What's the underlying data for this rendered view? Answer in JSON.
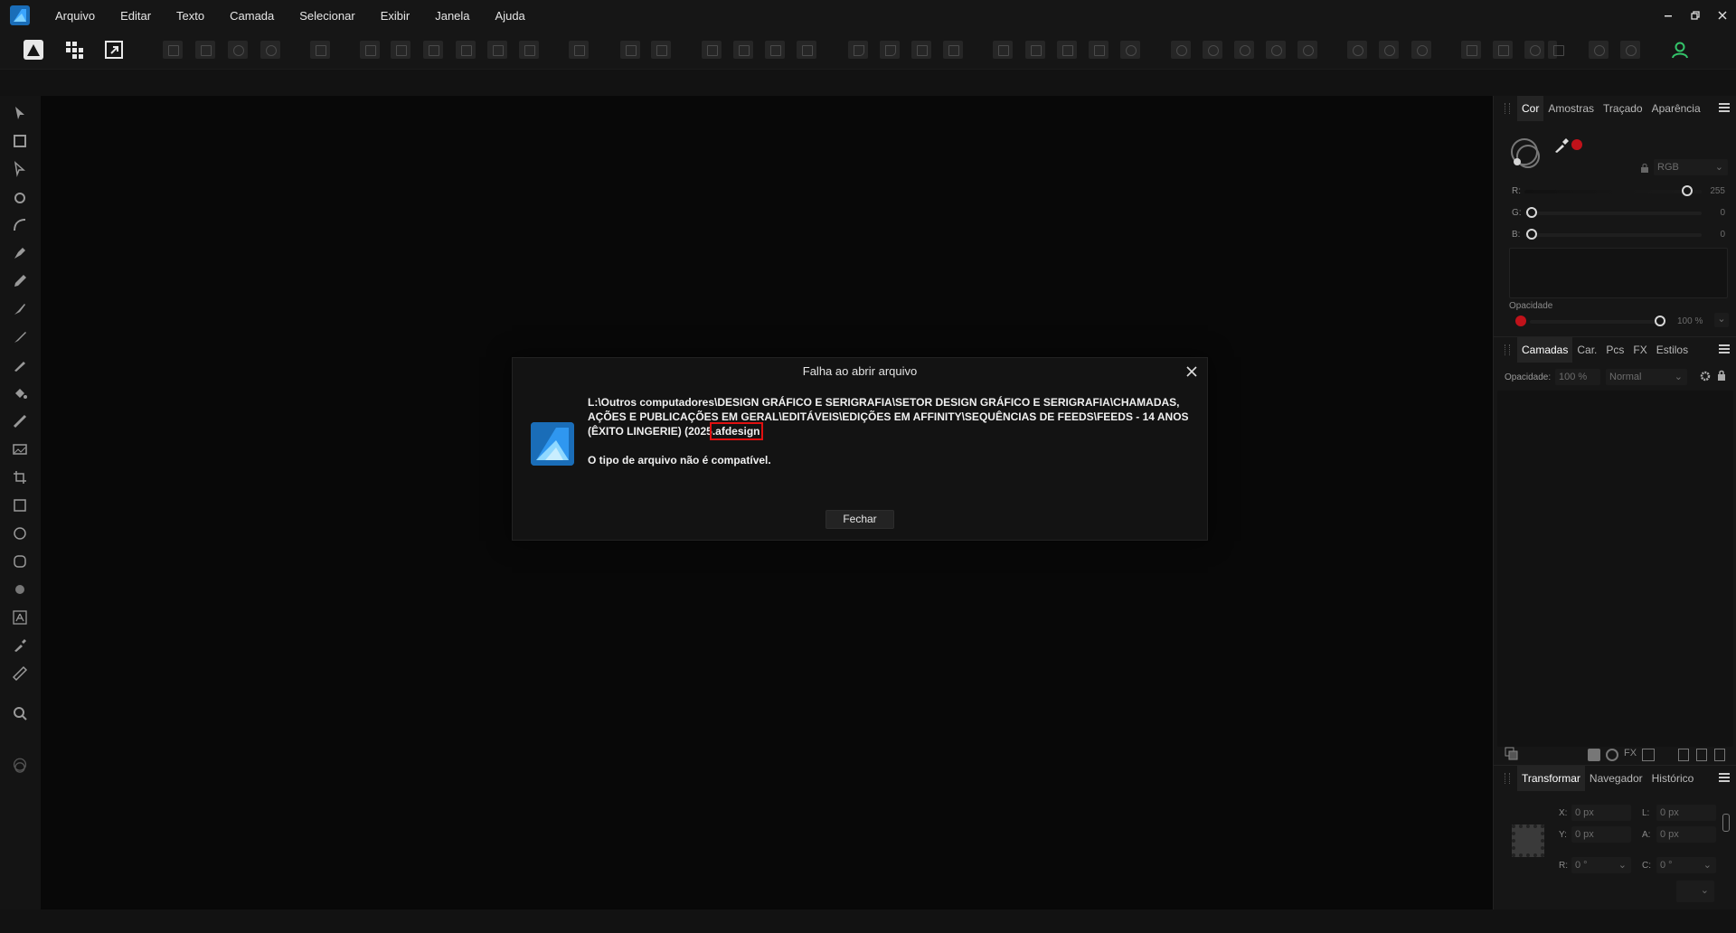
{
  "menubar": {
    "items": [
      "Arquivo",
      "Editar",
      "Texto",
      "Camada",
      "Selecionar",
      "Exibir",
      "Janela",
      "Ajuda"
    ]
  },
  "colors": {
    "accent": "#1a6db8",
    "highlight": "#e01010",
    "active_color": "#c0121a"
  },
  "color_panel": {
    "tabs": [
      "Cor",
      "Amostras",
      "Traçado",
      "Aparência"
    ],
    "mode": "RGB",
    "r_label": "R:",
    "r_value": "255",
    "g_label": "G:",
    "g_value": "0",
    "b_label": "B:",
    "b_value": "0",
    "opacity_label": "Opacidade",
    "opacity_value": "100 %",
    "icons": [
      "color-wheel-icon",
      "eyedropper-icon",
      "lock-icon"
    ]
  },
  "layers_panel": {
    "tabs": [
      "Camadas",
      "Car.",
      "Pcs",
      "FX",
      "Estilos"
    ],
    "opacity_label": "Opacidade:",
    "opacity_value": "100 %",
    "blend_mode": "Normal"
  },
  "transform_panel": {
    "tabs": [
      "Transformar",
      "Navegador",
      "Histórico"
    ],
    "x_label": "X:",
    "x_value": "0 px",
    "y_label": "Y:",
    "y_value": "0 px",
    "w_label": "L:",
    "w_value": "0 px",
    "h_label": "A:",
    "h_value": "0 px",
    "r_label": "R:",
    "r_value": "0 °",
    "s_label": "C:",
    "s_value": "0 °"
  },
  "dialog": {
    "title": "Falha ao abrir arquivo",
    "path_main": "L:\\Outros computadores\\DESIGN GRÁFICO E SERIGRAFIA\\SETOR DESIGN GRÁFICO E SERIGRAFIA\\CHAMADAS, AÇÕES E PUBLICAÇÕES EM GERAL\\EDITÁVEIS\\EDIÇÕES EM AFFINITY\\SEQUÊNCIAS DE FEEDS\\FEEDS - 14 ANOS (ÊXITO LINGERIE) (2025",
    "path_ext": ".afdesign",
    "message": "O tipo de arquivo não é compatível.",
    "close_button": "Fechar"
  }
}
